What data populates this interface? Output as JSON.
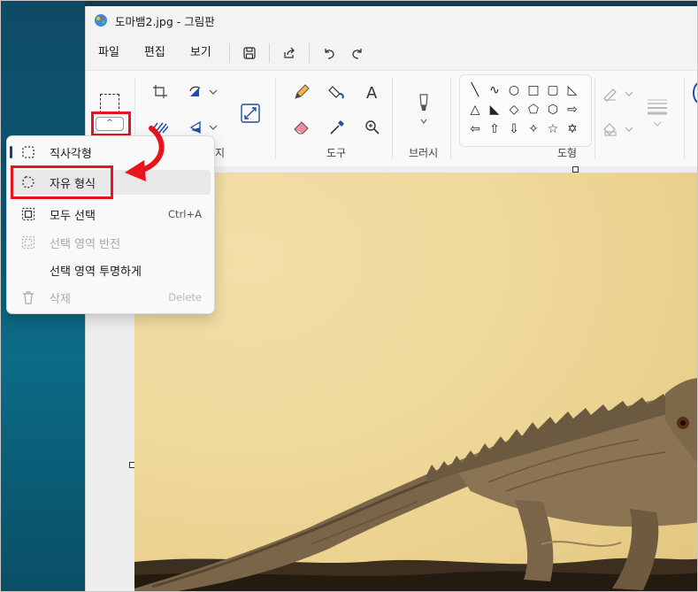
{
  "window": {
    "title": "도마뱀2.jpg - 그림판"
  },
  "menubar": {
    "items": [
      "파일",
      "편집",
      "보기"
    ]
  },
  "ribbon": {
    "groups": {
      "image_label": "지",
      "tools_label": "도구",
      "brush_label": "브러시",
      "shapes_label": "도형"
    }
  },
  "dropdown": {
    "items": [
      {
        "label": "직사각형",
        "shortcut": "",
        "disabled": false
      },
      {
        "label": "자유 형식",
        "shortcut": "",
        "disabled": false
      },
      {
        "label": "모두 선택",
        "shortcut": "Ctrl+A",
        "disabled": false
      },
      {
        "label": "선택 영역 반전",
        "shortcut": "",
        "disabled": true
      },
      {
        "label": "선택 영역 투명하게",
        "shortcut": "",
        "disabled": false
      },
      {
        "label": "삭제",
        "shortcut": "Delete",
        "disabled": true
      }
    ]
  },
  "shapes": [
    "╲",
    "∿",
    "○",
    "□",
    "▢",
    "◺",
    "△",
    "◣",
    "◇",
    "⬠",
    "⬡",
    "⇨",
    "⇦",
    "⇧",
    "⇩",
    "✧",
    "☆",
    "✡"
  ],
  "colors": {
    "annotation_red": "#e8131c",
    "accent_blue": "#1a3d8f"
  }
}
